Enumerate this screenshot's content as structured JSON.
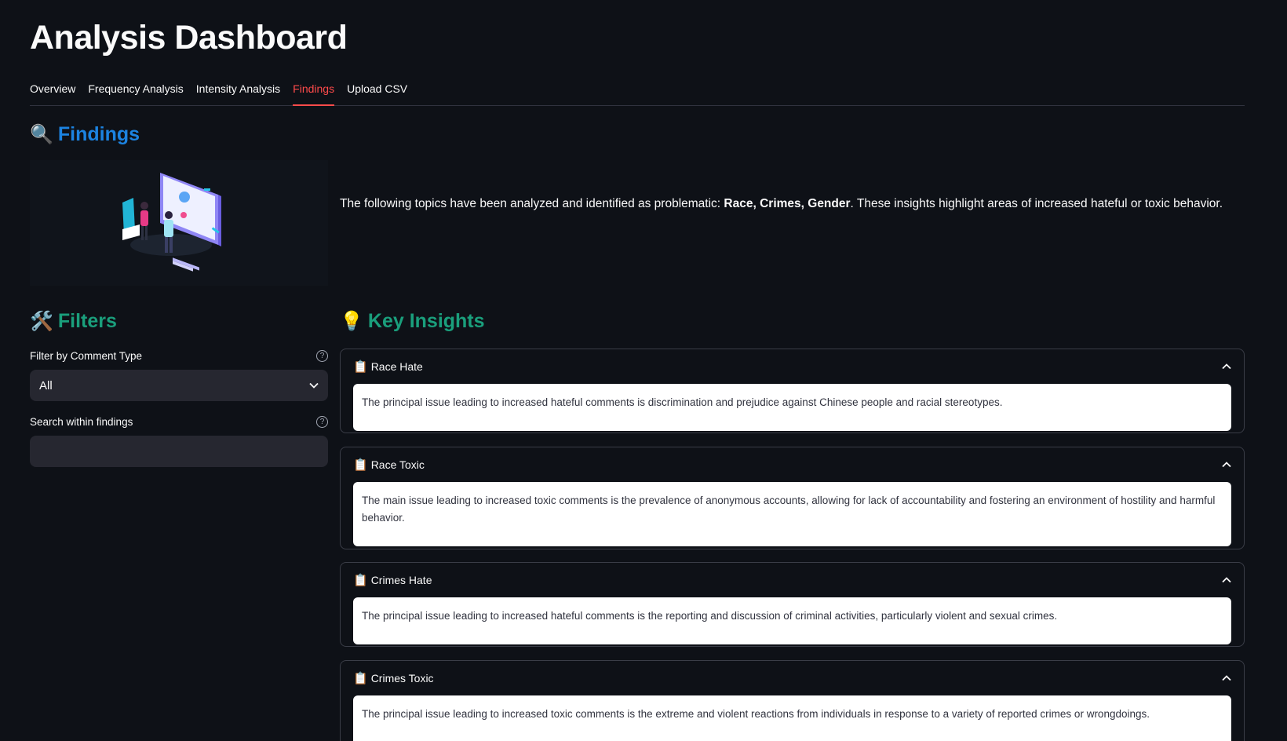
{
  "page_title": "Analysis Dashboard",
  "tabs": [
    {
      "label": "Overview"
    },
    {
      "label": "Frequency Analysis"
    },
    {
      "label": "Intensity Analysis"
    },
    {
      "label": "Findings"
    },
    {
      "label": "Upload CSV"
    }
  ],
  "active_tab": "Findings",
  "findings": {
    "heading": "Findings",
    "icon": "🔍",
    "intro_prefix": "The following topics have been analyzed and identified as problematic: ",
    "intro_topics": "Race, Crimes, Gender",
    "intro_suffix": ". These insights highlight areas of increased hateful or toxic behavior."
  },
  "filters": {
    "heading": "Filters",
    "icon": "🛠️",
    "comment_type_label": "Filter by Comment Type",
    "comment_type_value": "All",
    "search_label": "Search within findings",
    "search_value": "",
    "help_glyph": "?"
  },
  "insights": {
    "heading": "Key Insights",
    "icon": "💡",
    "items": [
      {
        "icon": "📋",
        "title": "Race Hate",
        "text": "The principal issue leading to increased hateful comments is discrimination and prejudice against Chinese people and racial stereotypes."
      },
      {
        "icon": "📋",
        "title": "Race Toxic",
        "text": "The main issue leading to increased toxic comments is the prevalence of anonymous accounts, allowing for lack of accountability and fostering an environment of hostility and harmful behavior."
      },
      {
        "icon": "📋",
        "title": "Crimes Hate",
        "text": "The principal issue leading to increased hateful comments is the reporting and discussion of criminal activities, particularly violent and sexual crimes."
      },
      {
        "icon": "📋",
        "title": "Crimes Toxic",
        "text": "The principal issue leading to increased toxic comments is the extreme and violent reactions from individuals in response to a variety of reported crimes or wrongdoings."
      }
    ]
  },
  "colors": {
    "background": "#0e1117",
    "accent": "#ff4b4b",
    "findings_heading": "#1c83e1",
    "section_heading": "#1a9f7c"
  }
}
